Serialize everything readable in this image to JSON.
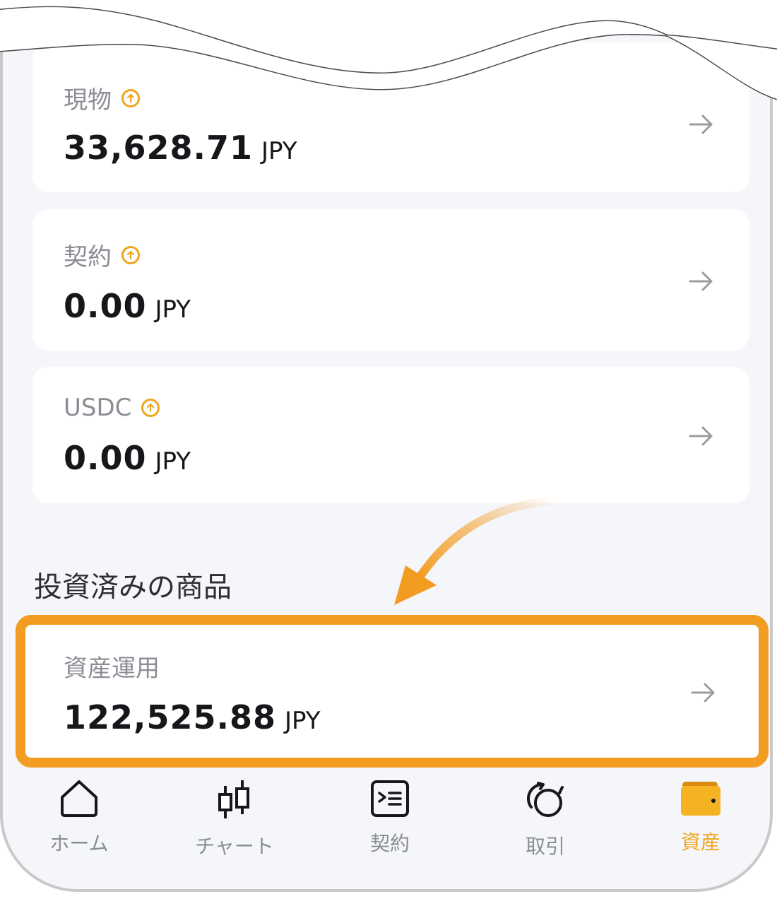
{
  "accounts": [
    {
      "label": "現物",
      "amount": "33,628.71",
      "unit": "JPY"
    },
    {
      "label": "契約",
      "amount": "0.00",
      "unit": "JPY"
    },
    {
      "label": "USDC",
      "amount": "0.00",
      "unit": "JPY"
    }
  ],
  "invested": {
    "section_title": "投資済みの商品",
    "label": "資産運用",
    "amount": "122,525.88",
    "unit": "JPY"
  },
  "nav": [
    {
      "label": "ホーム",
      "icon": "home-icon",
      "active": false
    },
    {
      "label": "チャート",
      "icon": "candlestick-chart-icon",
      "active": false
    },
    {
      "label": "契約",
      "icon": "contract-icon",
      "active": false
    },
    {
      "label": "取引",
      "icon": "exchange-icon",
      "active": false
    },
    {
      "label": "資産",
      "icon": "wallet-icon",
      "active": true
    }
  ],
  "colors": {
    "accent": "#f0a51e",
    "highlight": "#f39c22",
    "background": "#f5f6fa",
    "card": "#ffffff",
    "muted_text": "#8a8d93",
    "primary_text": "#16171a"
  }
}
